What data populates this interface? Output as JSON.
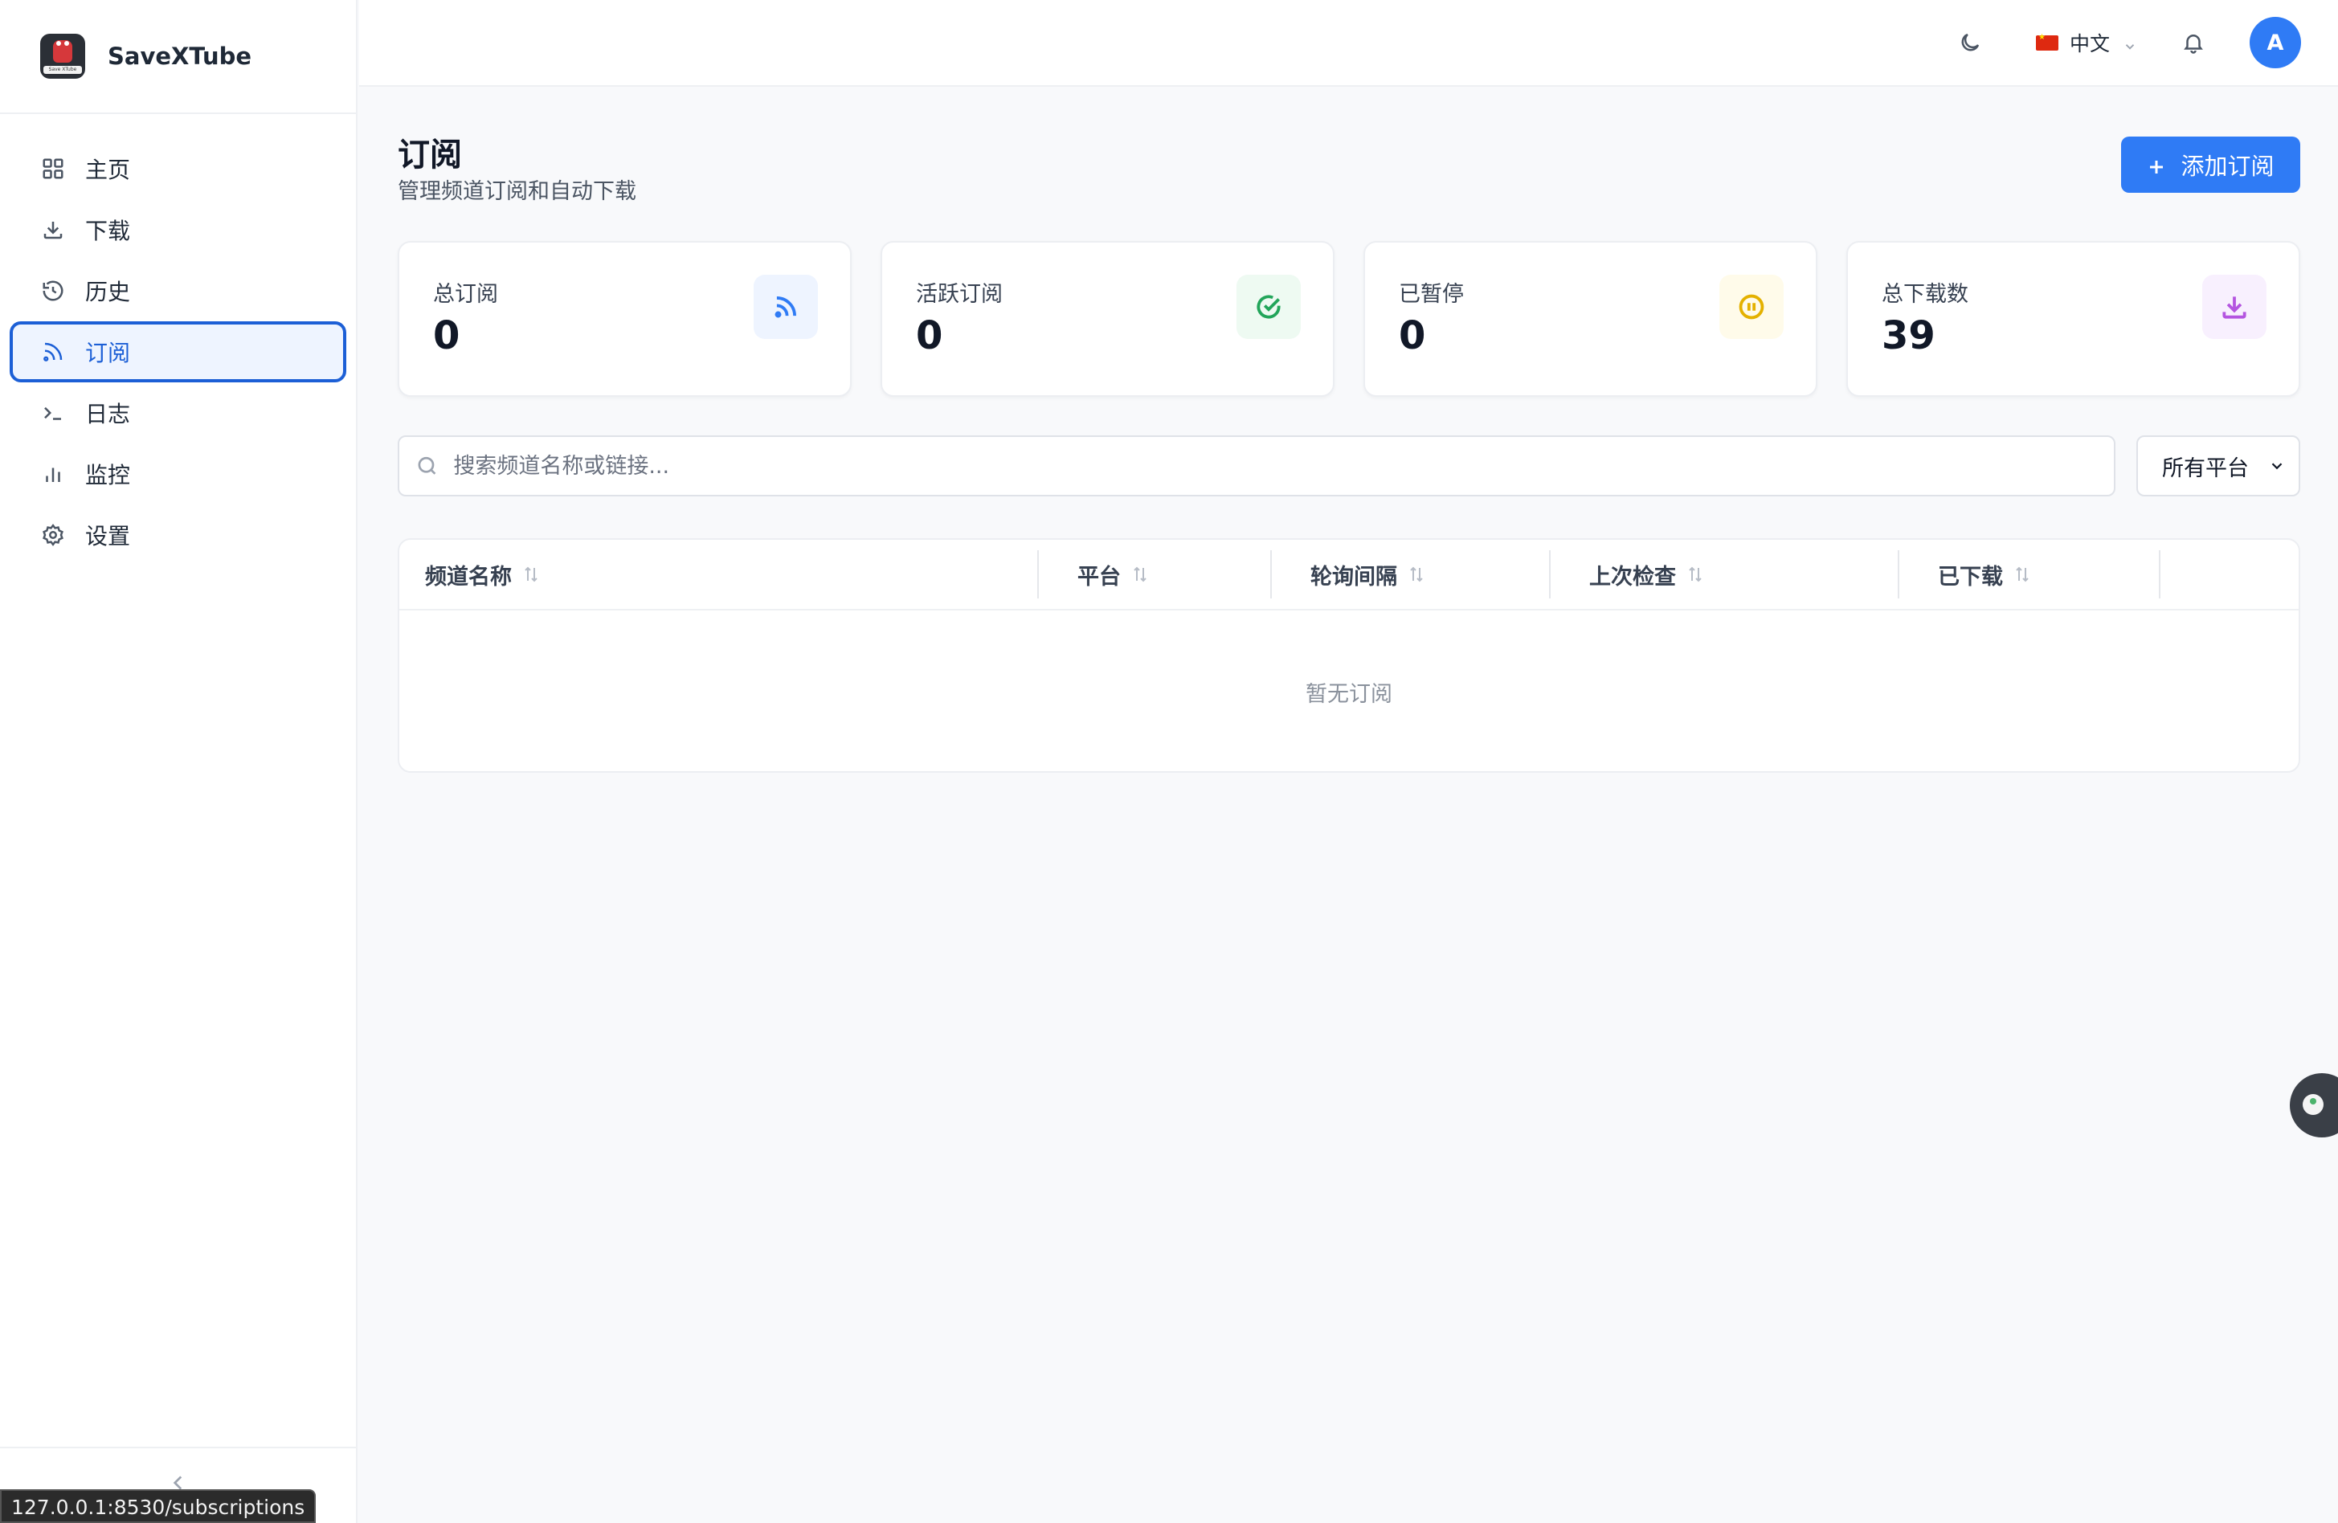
{
  "app": {
    "name": "SaveXTube",
    "logo_text": "Save XTube"
  },
  "sidebar": {
    "items": [
      {
        "label": "主页",
        "icon": "grid-icon"
      },
      {
        "label": "下载",
        "icon": "download-icon"
      },
      {
        "label": "历史",
        "icon": "history-icon"
      },
      {
        "label": "订阅",
        "icon": "rss-icon",
        "active": true
      },
      {
        "label": "日志",
        "icon": "terminal-icon"
      },
      {
        "label": "监控",
        "icon": "bar-chart-icon"
      },
      {
        "label": "设置",
        "icon": "gear-icon"
      }
    ]
  },
  "header": {
    "language": "中文"
  },
  "user": {
    "avatar_initial": "A"
  },
  "page": {
    "title": "订阅",
    "subtitle": "管理频道订阅和自动下载",
    "add_button": "添加订阅"
  },
  "stats": [
    {
      "label": "总订阅",
      "value": "0",
      "icon": "rss-icon",
      "color": "#2f7bf5",
      "bg": "#eef4ff"
    },
    {
      "label": "活跃订阅",
      "value": "0",
      "icon": "check-circle-icon",
      "color": "#22a55a",
      "bg": "#eefaf2"
    },
    {
      "label": "已暂停",
      "value": "0",
      "icon": "pause-circle-icon",
      "color": "#e4b100",
      "bg": "#fffbea"
    },
    {
      "label": "总下载数",
      "value": "39",
      "icon": "download-icon",
      "color": "#b455e0",
      "bg": "#f8f0fe"
    }
  ],
  "filters": {
    "search_placeholder": "搜索频道名称或链接...",
    "platform_selected": "所有平台"
  },
  "table": {
    "columns": [
      "频道名称",
      "平台",
      "轮询间隔",
      "上次检查",
      "已下载"
    ],
    "empty_text": "暂无订阅"
  },
  "statusbar": {
    "url": "127.0.0.1:8530/subscriptions"
  },
  "colors": {
    "accent": "#2f7bf5",
    "active_nav": "#1c5fd6"
  }
}
